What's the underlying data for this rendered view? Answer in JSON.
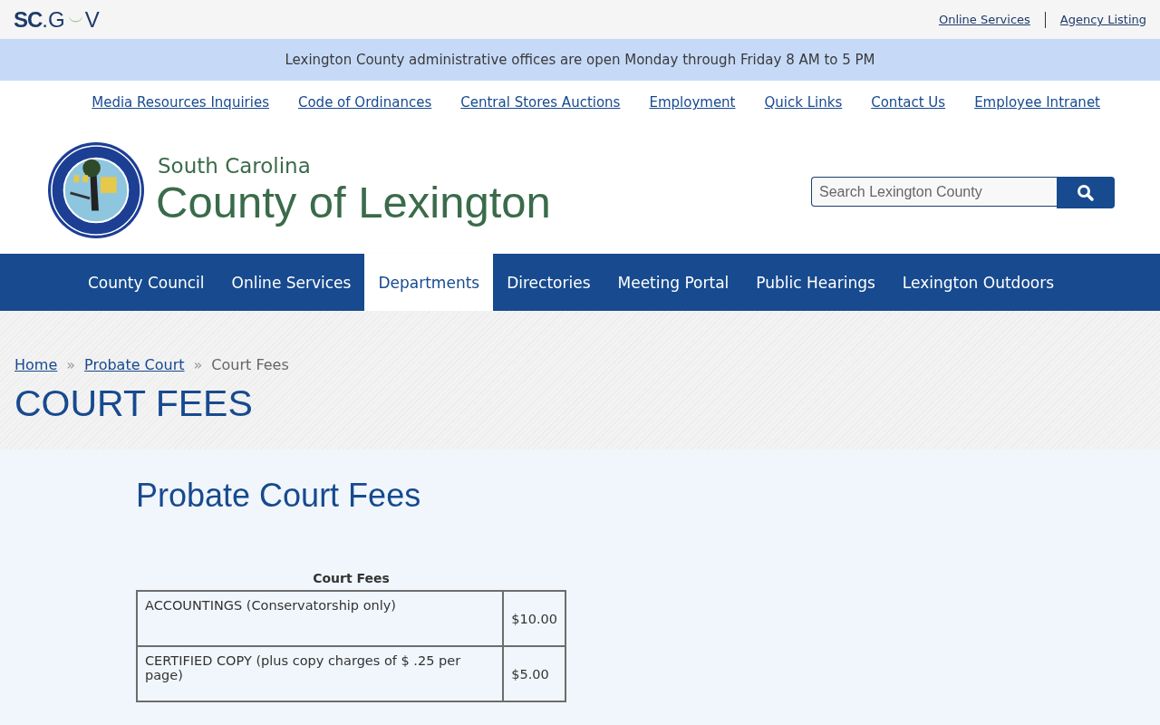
{
  "topbar": {
    "logo": {
      "bold": "SC",
      "middle": ".G",
      "end": "V"
    },
    "links": [
      "Online Services",
      "Agency Listing"
    ]
  },
  "alert": "Lexington County administrative offices are open Monday through Friday 8 AM to 5 PM",
  "utility_links": [
    "Media Resources Inquiries",
    "Code of Ordinances",
    "Central Stores Auctions",
    "Employment",
    "Quick Links",
    "Contact Us",
    "Employee Intranet"
  ],
  "header": {
    "state": "South Carolina",
    "title": "County of Lexington",
    "search": {
      "placeholder": "Search Lexington County"
    }
  },
  "nav": [
    {
      "label": "County Council",
      "selected": false
    },
    {
      "label": "Online Services",
      "selected": false
    },
    {
      "label": "Departments",
      "selected": true
    },
    {
      "label": "Directories",
      "selected": false
    },
    {
      "label": "Meeting Portal",
      "selected": false
    },
    {
      "label": "Public Hearings",
      "selected": false
    },
    {
      "label": "Lexington Outdoors",
      "selected": false
    }
  ],
  "breadcrumb": {
    "links": [
      "Home",
      "Probate Court"
    ],
    "separator": "»",
    "current": "Court Fees"
  },
  "page_title": "COURT FEES",
  "content": {
    "heading": "Probate Court Fees",
    "table": {
      "caption": "Court Fees",
      "rows": [
        {
          "item": "ACCOUNTINGS (Conservatorship only)",
          "fee": "$10.00"
        },
        {
          "item": "CERTIFIED COPY (plus copy charges of $ .25 per page)",
          "fee": "$5.00"
        }
      ]
    }
  }
}
